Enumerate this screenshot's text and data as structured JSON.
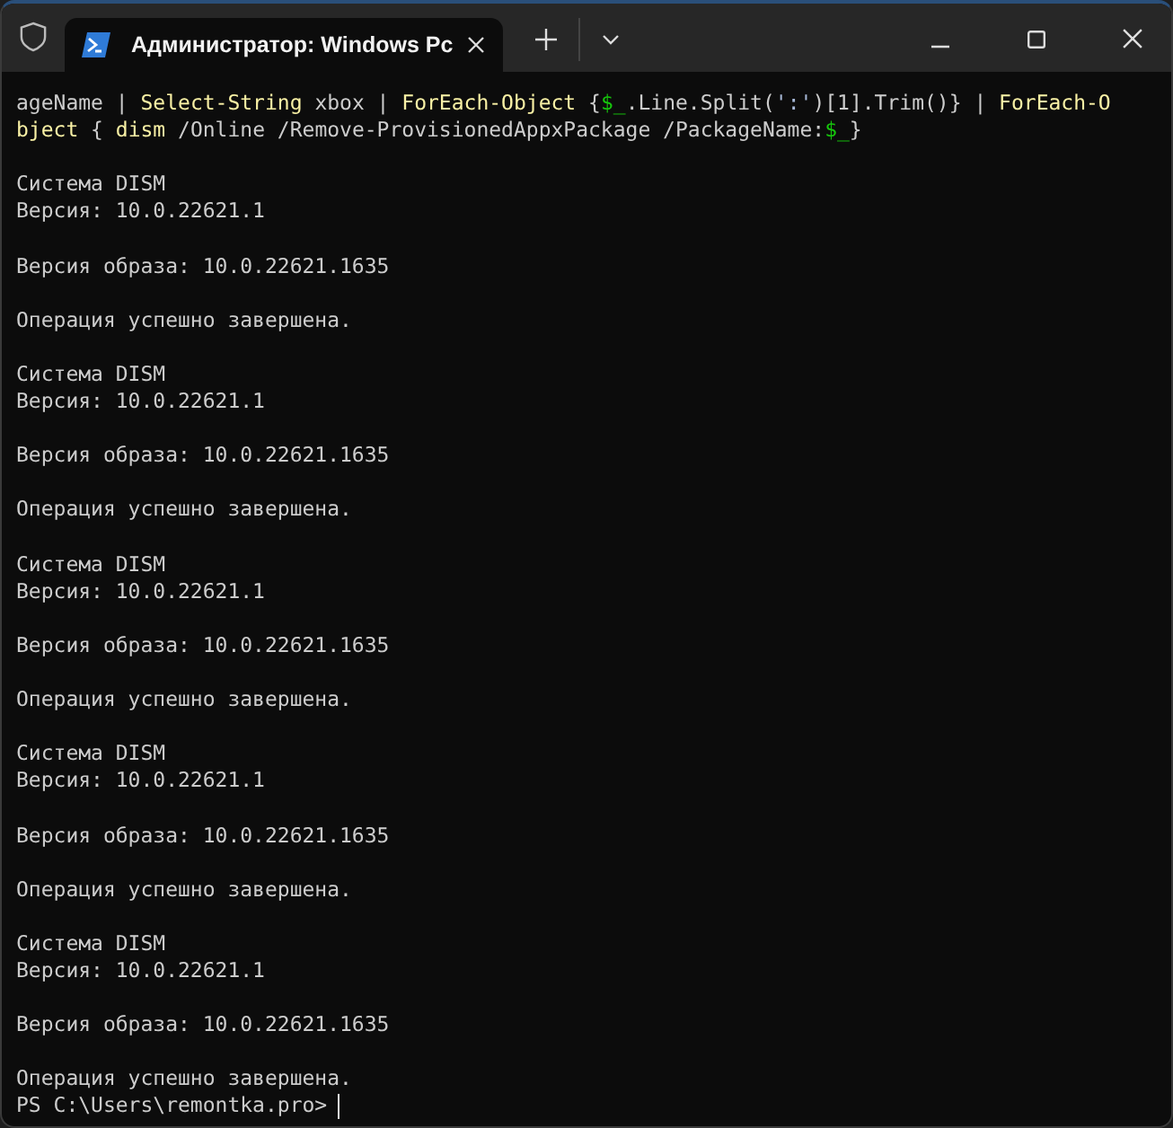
{
  "window": {
    "tab_title": "Администратор: Windows Pc"
  },
  "terminal": {
    "blocks": [
      {
        "lines": [
          {
            "segments": [
              {
                "kind": "plain",
                "text": "ageName | "
              },
              {
                "kind": "command",
                "text": "Select-String"
              },
              {
                "kind": "plain",
                "text": " xbox | "
              },
              {
                "kind": "command",
                "text": "ForEach-Object"
              },
              {
                "kind": "plain",
                "text": " {"
              },
              {
                "kind": "variable",
                "text": "$_"
              },
              {
                "kind": "plain",
                "text": ".Line.Split("
              },
              {
                "kind": "string",
                "text": "':'"
              },
              {
                "kind": "plain",
                "text": ")[1].Trim()} | "
              },
              {
                "kind": "command",
                "text": "ForEach-O"
              }
            ]
          },
          {
            "segments": [
              {
                "kind": "command",
                "text": "bject"
              },
              {
                "kind": "plain",
                "text": " { "
              },
              {
                "kind": "command",
                "text": "dism"
              },
              {
                "kind": "plain",
                "text": " /Online /Remove-ProvisionedAppxPackage /PackageName:"
              },
              {
                "kind": "variable",
                "text": "$_"
              },
              {
                "kind": "plain",
                "text": "}"
              }
            ]
          }
        ]
      },
      {
        "lines": [
          {
            "segments": [
              {
                "kind": "plain",
                "text": "Система DISM"
              }
            ]
          },
          {
            "segments": [
              {
                "kind": "plain",
                "text": "Версия: 10.0.22621.1"
              }
            ]
          }
        ]
      },
      {
        "lines": [
          {
            "segments": [
              {
                "kind": "plain",
                "text": "Версия образа: 10.0.22621.1635"
              }
            ]
          }
        ]
      },
      {
        "lines": [
          {
            "segments": [
              {
                "kind": "plain",
                "text": "Операция успешно завершена."
              }
            ]
          }
        ]
      },
      {
        "lines": [
          {
            "segments": [
              {
                "kind": "plain",
                "text": "Система DISM"
              }
            ]
          },
          {
            "segments": [
              {
                "kind": "plain",
                "text": "Версия: 10.0.22621.1"
              }
            ]
          }
        ]
      },
      {
        "lines": [
          {
            "segments": [
              {
                "kind": "plain",
                "text": "Версия образа: 10.0.22621.1635"
              }
            ]
          }
        ]
      },
      {
        "lines": [
          {
            "segments": [
              {
                "kind": "plain",
                "text": "Операция успешно завершена."
              }
            ]
          }
        ]
      },
      {
        "lines": [
          {
            "segments": [
              {
                "kind": "plain",
                "text": "Система DISM"
              }
            ]
          },
          {
            "segments": [
              {
                "kind": "plain",
                "text": "Версия: 10.0.22621.1"
              }
            ]
          }
        ]
      },
      {
        "lines": [
          {
            "segments": [
              {
                "kind": "plain",
                "text": "Версия образа: 10.0.22621.1635"
              }
            ]
          }
        ]
      },
      {
        "lines": [
          {
            "segments": [
              {
                "kind": "plain",
                "text": "Операция успешно завершена."
              }
            ]
          }
        ]
      },
      {
        "lines": [
          {
            "segments": [
              {
                "kind": "plain",
                "text": "Система DISM"
              }
            ]
          },
          {
            "segments": [
              {
                "kind": "plain",
                "text": "Версия: 10.0.22621.1"
              }
            ]
          }
        ]
      },
      {
        "lines": [
          {
            "segments": [
              {
                "kind": "plain",
                "text": "Версия образа: 10.0.22621.1635"
              }
            ]
          }
        ]
      },
      {
        "lines": [
          {
            "segments": [
              {
                "kind": "plain",
                "text": "Операция успешно завершена."
              }
            ]
          }
        ]
      },
      {
        "lines": [
          {
            "segments": [
              {
                "kind": "plain",
                "text": "Система DISM"
              }
            ]
          },
          {
            "segments": [
              {
                "kind": "plain",
                "text": "Версия: 10.0.22621.1"
              }
            ]
          }
        ]
      },
      {
        "lines": [
          {
            "segments": [
              {
                "kind": "plain",
                "text": "Версия образа: 10.0.22621.1635"
              }
            ]
          }
        ]
      },
      {
        "lines": [
          {
            "segments": [
              {
                "kind": "plain",
                "text": "Операция успешно завершена."
              }
            ]
          }
        ]
      }
    ],
    "prompt": {
      "text": "PS C:\\Users\\remontka.pro>",
      "cursor": true
    }
  }
}
